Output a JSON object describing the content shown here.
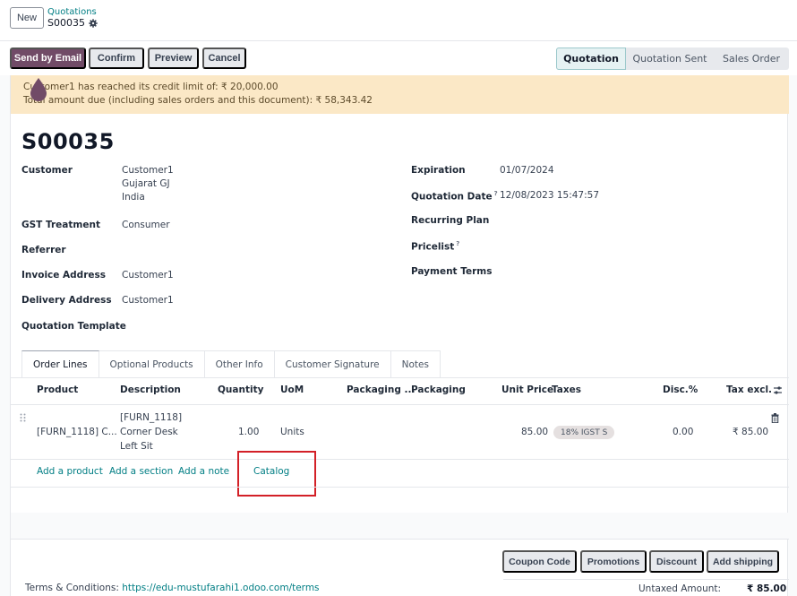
{
  "topbar": {
    "new_label": "New",
    "breadcrumb_parent": "Quotations",
    "breadcrumb_current": "S00035",
    "gear_icon": "gear-icon"
  },
  "actions": {
    "send_by_email": "Send by Email",
    "confirm": "Confirm",
    "preview": "Preview",
    "cancel": "Cancel"
  },
  "statusbar": {
    "stages": [
      "Quotation",
      "Quotation Sent",
      "Sales Order"
    ],
    "active": "Quotation"
  },
  "alert": {
    "line1": "Customer1 has reached its credit limit of: ₹ 20,000.00",
    "line2": "Total amount due (including sales orders and this document): ₹ 58,343.42"
  },
  "record": {
    "title": "S00035",
    "left_fields": [
      {
        "label": "Customer",
        "value_lines": [
          "Customer1",
          "Gujarat GJ",
          "India"
        ]
      },
      {
        "label": "GST Treatment",
        "value": "Consumer"
      },
      {
        "label": "Referrer",
        "value": ""
      },
      {
        "label": "Invoice Address",
        "value": "Customer1"
      },
      {
        "label": "Delivery Address",
        "value": "Customer1"
      },
      {
        "label": "Quotation Template",
        "value": ""
      }
    ],
    "right_fields": [
      {
        "label": "Expiration",
        "value": "01/07/2024"
      },
      {
        "label": "Quotation Date",
        "value": "12/08/2023 15:47:57",
        "help": "?"
      },
      {
        "label": "Recurring Plan",
        "value": ""
      },
      {
        "label": "Pricelist",
        "value": "",
        "help": "?"
      },
      {
        "label": "Payment Terms",
        "value": ""
      }
    ]
  },
  "tabs": [
    "Order Lines",
    "Optional Products",
    "Other Info",
    "Customer Signature",
    "Notes"
  ],
  "active_tab": "Order Lines",
  "order_lines": {
    "columns": [
      "Product",
      "Description",
      "Quantity",
      "UoM",
      "Packaging ...",
      "Packaging",
      "Unit Price",
      "Taxes",
      "Disc.%",
      "Tax excl."
    ],
    "rows": [
      {
        "product": "[FURN_1118] C...",
        "description_lines": [
          "[FURN_1118]",
          "Corner Desk",
          "Left Sit"
        ],
        "quantity": "1.00",
        "uom": "Units",
        "packaging_qty": "",
        "packaging": "",
        "unit_price": "85.00",
        "taxes": "18% IGST S",
        "discount": "0.00",
        "subtotal": "₹ 85.00"
      }
    ],
    "add_links": [
      "Add a product",
      "Add a section",
      "Add a note",
      "Catalog"
    ],
    "highlight_color": "#d32027"
  },
  "footer": {
    "buttons": [
      "Coupon Code",
      "Promotions",
      "Discount",
      "Add shipping"
    ],
    "terms_label": "Terms & Conditions:",
    "terms_url": "https://edu-mustufarahi1.odoo.com/terms",
    "untaxed_label": "Untaxed Amount:",
    "untaxed_value": "₹ 85.00"
  },
  "colors": {
    "primary": "#714b67",
    "link": "#017e84",
    "alert_bg": "#fbe8c6"
  }
}
